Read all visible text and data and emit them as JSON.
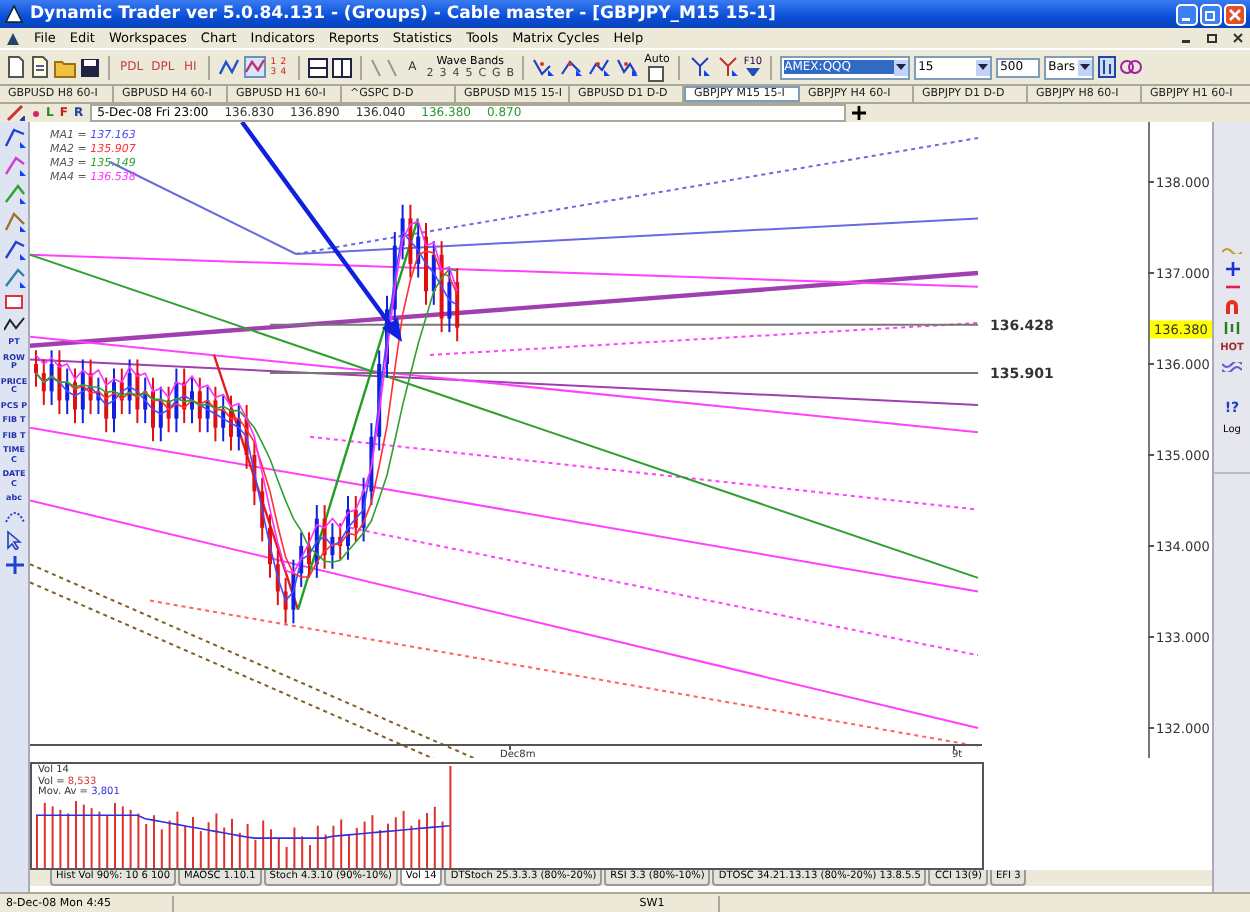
{
  "window": {
    "title": "Dynamic Trader ver 5.0.84.131 - (Groups) - Cable master - [GBPJPY_M15 15-1]"
  },
  "menu": [
    "File",
    "Edit",
    "Workspaces",
    "Chart",
    "Indicators",
    "Reports",
    "Statistics",
    "Tools",
    "Matrix Cycles",
    "Help"
  ],
  "toolbar": {
    "line_buttons": [
      "PDL",
      "DPL",
      "HI"
    ],
    "pattern_numbers": [
      "1",
      "2",
      "3",
      "4"
    ],
    "text_button": "A",
    "wave_bands_label": "Wave Bands",
    "wave_numbers": [
      "2",
      "3",
      "4",
      "5",
      "C",
      "G",
      "B"
    ],
    "auto_label": "Auto",
    "auto_checked": false,
    "f10_label": "F10",
    "symbol": "AMEX:QQQ",
    "interval": "15",
    "bar_count": "500",
    "bar_unit": "Bars"
  },
  "chart_tabs": [
    {
      "label": "GBPUSD  H8 60-I",
      "selected": false
    },
    {
      "label": "GBPUSD  H4 60-I",
      "selected": false
    },
    {
      "label": "GBPUSD  H1 60-I",
      "selected": false
    },
    {
      "label": "^GSPC  D-D",
      "selected": false
    },
    {
      "label": "GBPUSD  M15 15-I",
      "selected": false
    },
    {
      "label": "GBPUSD  D1 D-D",
      "selected": false
    },
    {
      "label": "GBPJPY  M15 15-I",
      "selected": true
    },
    {
      "label": "GBPJPY  H4 60-I",
      "selected": false
    },
    {
      "label": "GBPJPY  D1 D-D",
      "selected": false
    },
    {
      "label": "GBPJPY  H8 60-I",
      "selected": false
    },
    {
      "label": "GBPJPY  H1 60-I",
      "selected": false
    }
  ],
  "chart_header": {
    "flags": [
      "L",
      "F",
      "R"
    ],
    "date": "5-Dec-08 Fri 23:00",
    "values": [
      {
        "text": "136.830",
        "color": "#333333"
      },
      {
        "text": "136.890",
        "color": "#333333"
      },
      {
        "text": "136.040",
        "color": "#333333"
      },
      {
        "text": "136.380",
        "color": "#2a9a2a"
      },
      {
        "text": "0.870",
        "color": "#2a9a2a"
      }
    ]
  },
  "moving_averages": [
    {
      "label": "MA1 =",
      "value": "137.163",
      "color": "#4a4aff"
    },
    {
      "label": "MA2 =",
      "value": "135.907",
      "color": "#ff3030"
    },
    {
      "label": "MA3 =",
      "value": "135.149",
      "color": "#30a030"
    },
    {
      "label": "MA4 =",
      "value": "136.538",
      "color": "#ff30ff"
    }
  ],
  "palette_labels": [
    "PT",
    "ROW P",
    "PRICE C",
    "PCS P",
    "FIB T",
    "FIB T",
    "TIME C",
    "DATE C",
    "abc"
  ],
  "price_axis": {
    "ticks": [
      "138.000",
      "137.000",
      "136.000",
      "135.000",
      "134.000",
      "133.000",
      "132.000"
    ],
    "current_price": "136.380",
    "line_labels": [
      "136.428",
      "135.901"
    ]
  },
  "time_axis": [
    "Dec8m",
    "9t"
  ],
  "right_tools": [
    "HOT",
    "!?",
    "Log"
  ],
  "volume_panel": {
    "title": "Vol 14",
    "readings": [
      {
        "label": "Vol =",
        "value": "8,533",
        "color": "#e03030"
      },
      {
        "label": "Mov. Av =",
        "value": "3,801",
        "color": "#3030e0"
      }
    ]
  },
  "indicator_tabs": [
    {
      "label": "Hist Vol 90%: 10 6 100",
      "selected": false
    },
    {
      "label": "MAOSC 1.10.1",
      "selected": false
    },
    {
      "label": "Stoch 4.3.10 (90%-10%)",
      "selected": false
    },
    {
      "label": "Vol 14",
      "selected": true
    },
    {
      "label": "DTStoch 25.3.3.3 (80%-20%)",
      "selected": false
    },
    {
      "label": "RSI 3.3 (80%-10%)",
      "selected": false
    },
    {
      "label": "DTOSC 34.21.13.13 (80%-20%) 13.8.5.5",
      "selected": false
    },
    {
      "label": "CCI 13(9)",
      "selected": false
    },
    {
      "label": "EFI 3",
      "selected": false
    }
  ],
  "status_bar": [
    "8-Dec-08 Mon 4:45",
    "SW1"
  ]
}
